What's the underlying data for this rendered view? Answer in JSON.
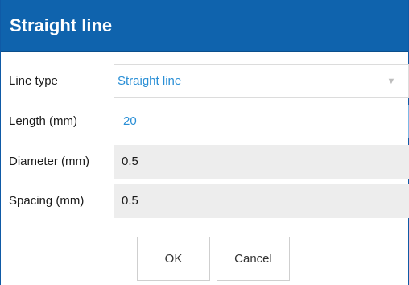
{
  "dialog": {
    "title": "Straight line"
  },
  "form": {
    "line_type": {
      "label": "Line type",
      "value": "Straight line",
      "icon": "chevron-down-icon"
    },
    "length": {
      "label": "Length (mm)",
      "value": "20"
    },
    "diameter": {
      "label": "Diameter (mm)",
      "value": "0.5"
    },
    "spacing": {
      "label": "Spacing (mm)",
      "value": "0.5"
    }
  },
  "buttons": {
    "ok_label": "OK",
    "cancel_label": "Cancel"
  },
  "colors": {
    "title_bar": "#0f63ad",
    "accent_text": "#2a8fd6",
    "readonly_bg": "#ededed"
  }
}
